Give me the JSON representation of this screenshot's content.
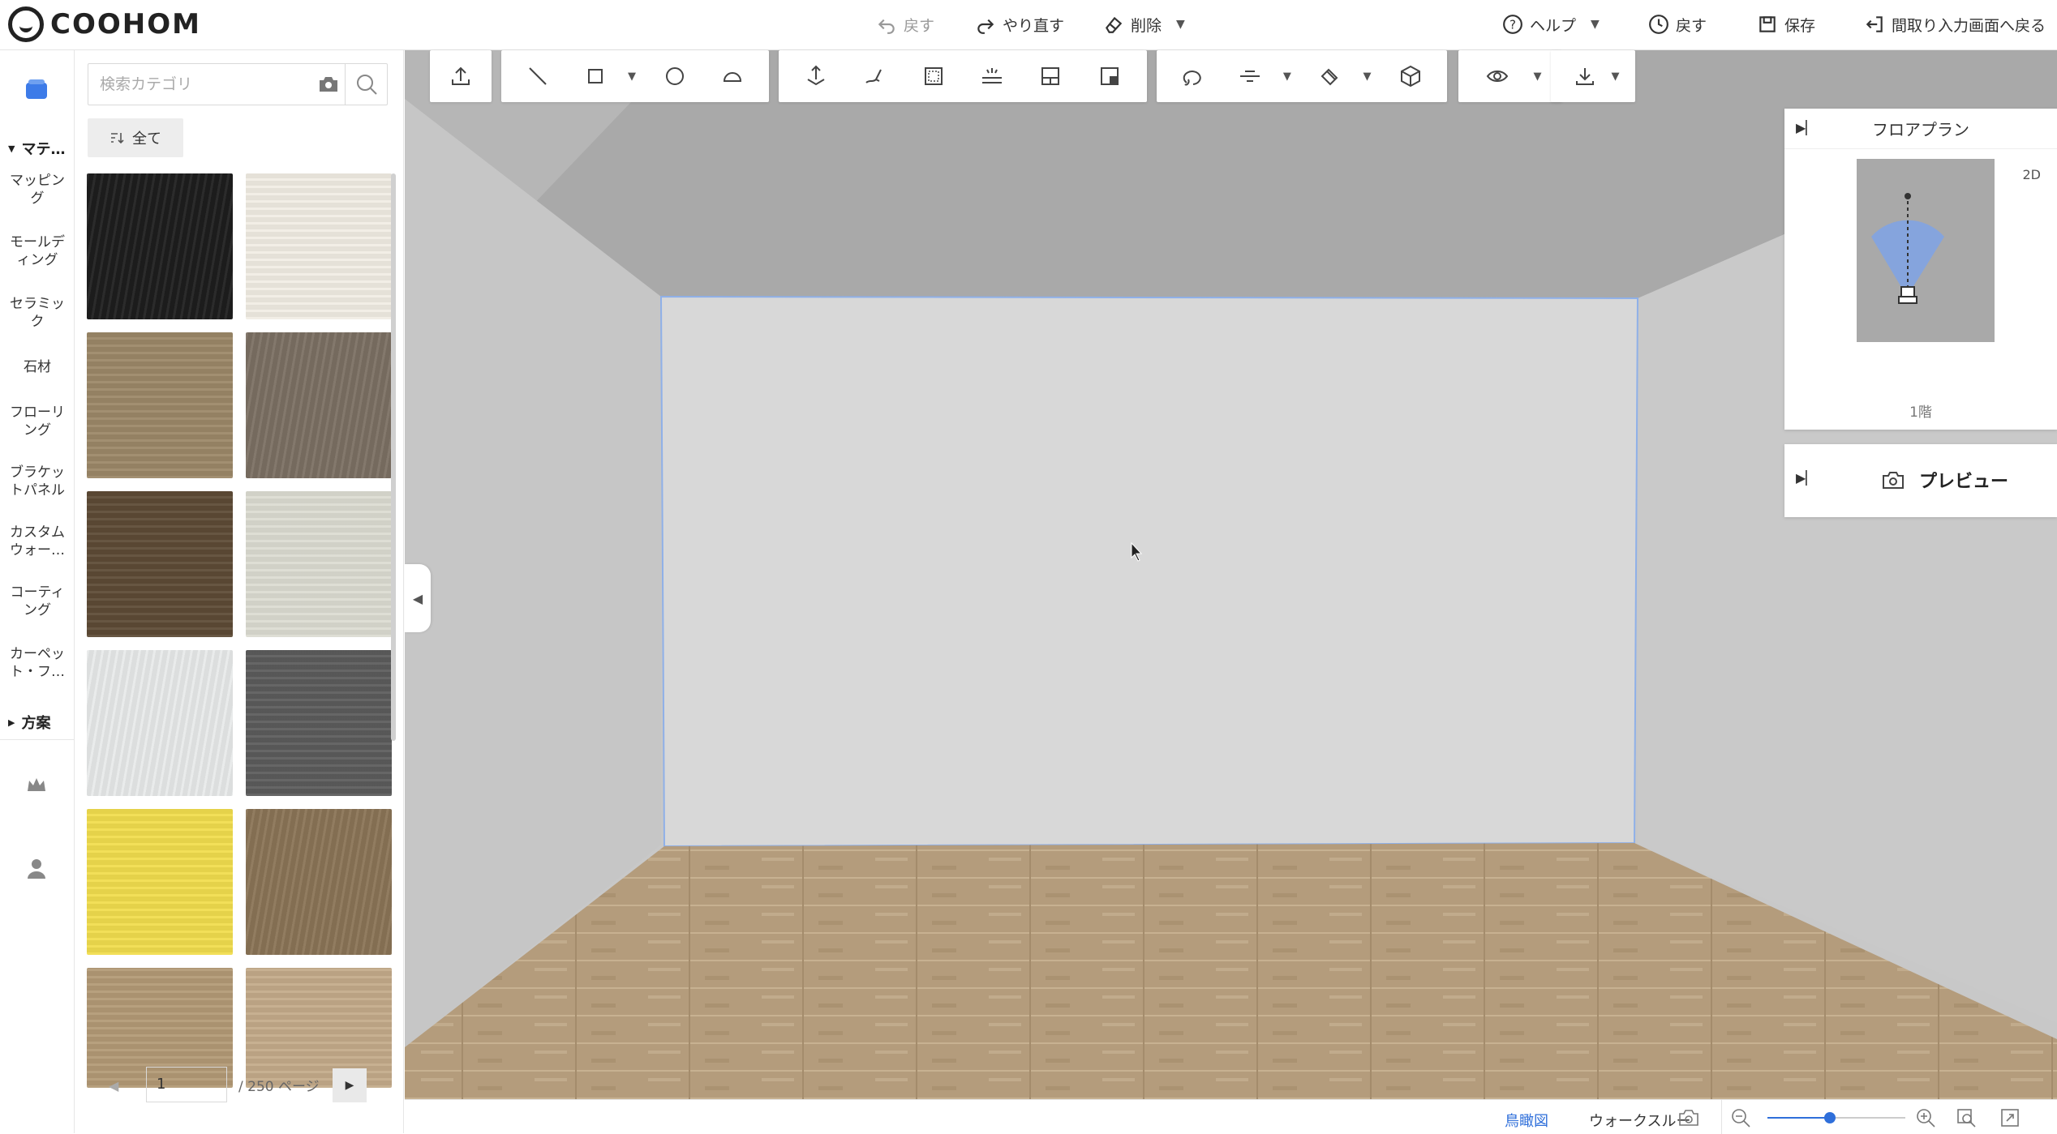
{
  "app": {
    "logo_text": "COOHOM"
  },
  "topbar": {
    "undo_label": "戻す",
    "redo_label": "やり直す",
    "delete_label": "削除",
    "help_label": "ヘルプ",
    "history_label": "戻す",
    "save_label": "保存",
    "back_to_floorplan_label": "間取り入力画面へ戻る"
  },
  "rail": {
    "materials_section": "マテ…",
    "items": [
      {
        "label": "マッピン\nグ"
      },
      {
        "label": "モールデ\nィング"
      },
      {
        "label": "セラミッ\nク"
      },
      {
        "label": "石材"
      },
      {
        "label": "フローリ\nング"
      },
      {
        "label": "ブラケッ\nトパネル"
      },
      {
        "label": "カスタム\nウォー…"
      },
      {
        "label": "コーティ\nング"
      },
      {
        "label": "カーペッ\nト・フ…"
      }
    ],
    "plans_section": "方案"
  },
  "panel": {
    "search_placeholder": "検索カテゴリ",
    "filter_label": "全て",
    "tiles": [
      {
        "name": "black-marble",
        "color": "#1e1e1e"
      },
      {
        "name": "cream-plaster",
        "color": "#f1ede4"
      },
      {
        "name": "oak-light",
        "color": "#9c8868"
      },
      {
        "name": "taupe-solid",
        "color": "#7b7063"
      },
      {
        "name": "walnut-brown",
        "color": "#5e4b36"
      },
      {
        "name": "pale-greige",
        "color": "#dcdcd2"
      },
      {
        "name": "white-marble",
        "color": "#e8eaea"
      },
      {
        "name": "grey-wood",
        "color": "#5c5c5c"
      },
      {
        "name": "yellow-solid",
        "color": "#f1dd4e"
      },
      {
        "name": "brown-granite",
        "color": "#8a7456"
      },
      {
        "name": "pine-planks",
        "color": "#b39a76"
      },
      {
        "name": "sand-planks",
        "color": "#c4ab8a"
      }
    ],
    "pager": {
      "current": "1",
      "total": "/ 250 ページ"
    }
  },
  "floorplan": {
    "title": "フロアプラン",
    "mode": "2D",
    "floor": "1階"
  },
  "preview": {
    "label": "プレビュー"
  },
  "bottombar": {
    "tab_birdseye": "鳥瞰図",
    "tab_walkthrough": "ウォークスルー",
    "zoom_level": 0.45
  },
  "colors": {
    "accent": "#2f6fda",
    "wall": "#d8d8d8",
    "ceiling": "#a9a9a9",
    "side_wall": "#c9c9c9",
    "floor": "#b49c7c"
  }
}
